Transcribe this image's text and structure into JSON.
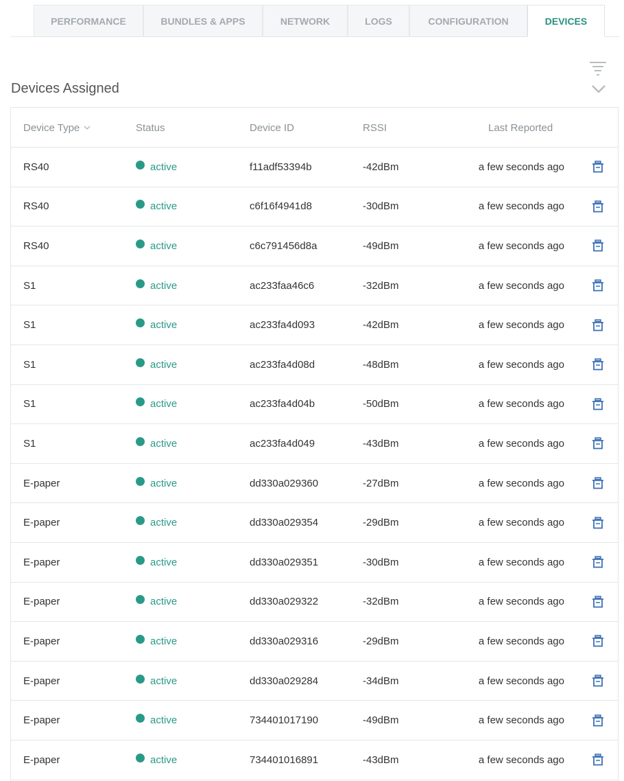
{
  "tabs": [
    {
      "label": "PERFORMANCE"
    },
    {
      "label": "BUNDLES & APPS"
    },
    {
      "label": "NETWORK"
    },
    {
      "label": "LOGS"
    },
    {
      "label": "CONFIGURATION"
    },
    {
      "label": "DEVICES"
    }
  ],
  "active_tab": "DEVICES",
  "section_title": "Devices Assigned",
  "table": {
    "headers": {
      "device_type": "Device Type",
      "status": "Status",
      "device_id": "Device ID",
      "rssi": "RSSI",
      "last_reported": "Last Reported"
    },
    "rows": [
      {
        "type": "RS40",
        "status": "active",
        "id": "f11adf53394b",
        "rssi": "-42dBm",
        "last": "a few seconds ago"
      },
      {
        "type": "RS40",
        "status": "active",
        "id": "c6f16f4941d8",
        "rssi": "-30dBm",
        "last": "a few seconds ago"
      },
      {
        "type": "RS40",
        "status": "active",
        "id": "c6c791456d8a",
        "rssi": "-49dBm",
        "last": "a few seconds ago"
      },
      {
        "type": "S1",
        "status": "active",
        "id": "ac233faa46c6",
        "rssi": "-32dBm",
        "last": "a few seconds ago"
      },
      {
        "type": "S1",
        "status": "active",
        "id": "ac233fa4d093",
        "rssi": "-42dBm",
        "last": "a few seconds ago"
      },
      {
        "type": "S1",
        "status": "active",
        "id": "ac233fa4d08d",
        "rssi": "-48dBm",
        "last": "a few seconds ago"
      },
      {
        "type": "S1",
        "status": "active",
        "id": "ac233fa4d04b",
        "rssi": "-50dBm",
        "last": "a few seconds ago"
      },
      {
        "type": "S1",
        "status": "active",
        "id": "ac233fa4d049",
        "rssi": "-43dBm",
        "last": "a few seconds ago"
      },
      {
        "type": "E-paper",
        "status": "active",
        "id": "dd330a029360",
        "rssi": "-27dBm",
        "last": "a few seconds ago"
      },
      {
        "type": "E-paper",
        "status": "active",
        "id": "dd330a029354",
        "rssi": "-29dBm",
        "last": "a few seconds ago"
      },
      {
        "type": "E-paper",
        "status": "active",
        "id": "dd330a029351",
        "rssi": "-30dBm",
        "last": "a few seconds ago"
      },
      {
        "type": "E-paper",
        "status": "active",
        "id": "dd330a029322",
        "rssi": "-32dBm",
        "last": "a few seconds ago"
      },
      {
        "type": "E-paper",
        "status": "active",
        "id": "dd330a029316",
        "rssi": "-29dBm",
        "last": "a few seconds ago"
      },
      {
        "type": "E-paper",
        "status": "active",
        "id": "dd330a029284",
        "rssi": "-34dBm",
        "last": "a few seconds ago"
      },
      {
        "type": "E-paper",
        "status": "active",
        "id": "734401017190",
        "rssi": "-49dBm",
        "last": "a few seconds ago"
      },
      {
        "type": "E-paper",
        "status": "active",
        "id": "734401016891",
        "rssi": "-43dBm",
        "last": "a few seconds ago"
      }
    ]
  },
  "icons": {
    "filter": "filter-icon",
    "collapse": "chevron-down-icon",
    "sort": "sort-down-icon",
    "delete": "trash-icon",
    "status_dot": "status-dot-icon"
  },
  "colors": {
    "accent": "#2a8f80",
    "status_active": "#2a9a88",
    "delete_icon": "#3a6fb5"
  }
}
